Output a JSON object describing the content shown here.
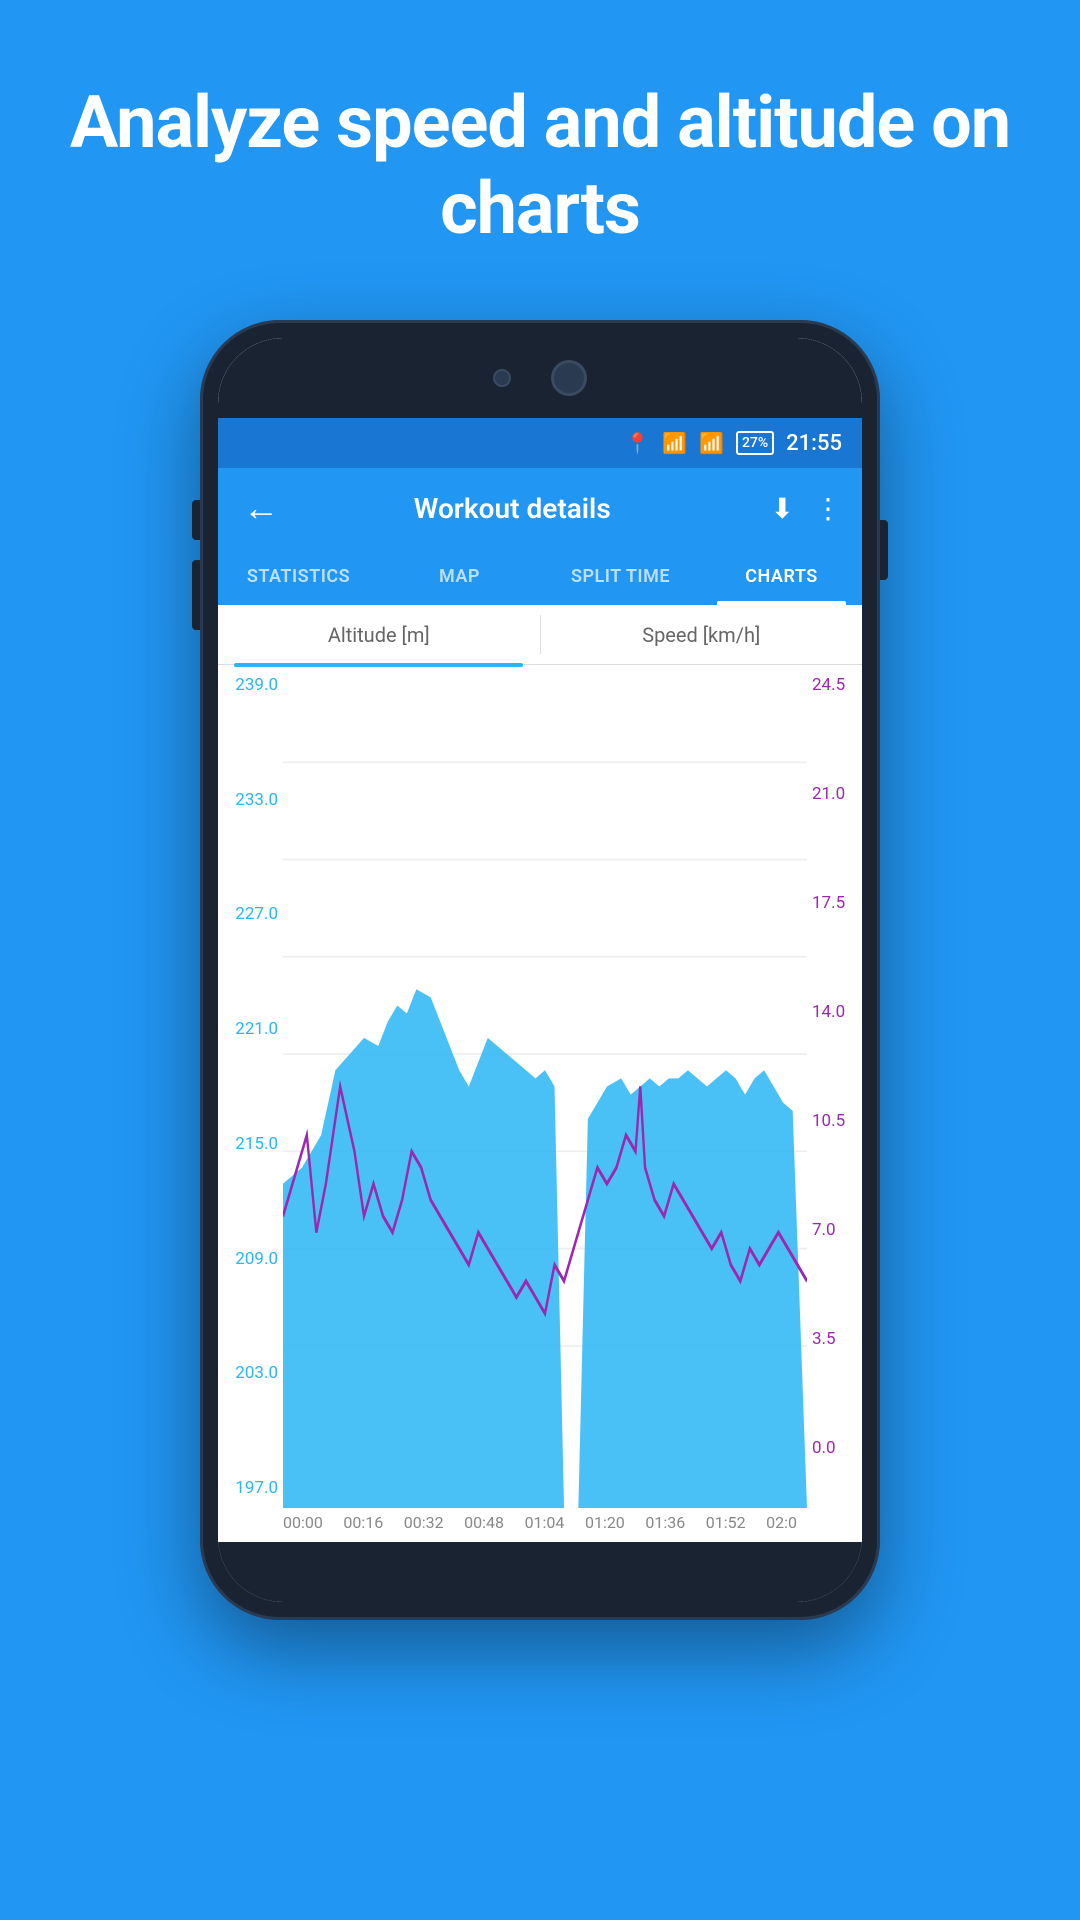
{
  "hero": {
    "text": "Analyze speed and altitude on charts"
  },
  "status_bar": {
    "battery": "27%",
    "time": "21:55"
  },
  "app_bar": {
    "title": "Workout details",
    "back_label": "←",
    "download_icon": "⬇",
    "more_icon": "⋮"
  },
  "tabs": [
    {
      "label": "STATISTICS",
      "active": false
    },
    {
      "label": "MAP",
      "active": false
    },
    {
      "label": "SPLIT TIME",
      "active": false
    },
    {
      "label": "CHARTS",
      "active": true
    }
  ],
  "chart": {
    "left_axis_label": "Altitude [m]",
    "right_axis_label": "Speed [km/h]",
    "y_left": [
      "239.0",
      "233.0",
      "227.0",
      "221.0",
      "215.0",
      "209.0",
      "203.0",
      "197.0"
    ],
    "y_right": [
      "24.5",
      "21.0",
      "17.5",
      "14.0",
      "10.5",
      "7.0",
      "3.5",
      "0.0"
    ],
    "x_labels": [
      "00:00",
      "00:16",
      "00:32",
      "00:48",
      "01:04",
      "01:20",
      "01:36",
      "01:52",
      "02:0"
    ]
  }
}
